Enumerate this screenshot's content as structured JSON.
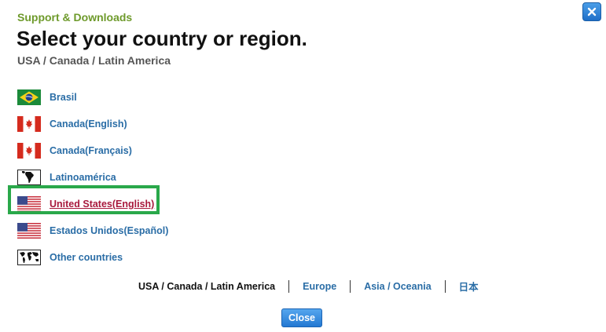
{
  "header": {
    "eyebrow": "Support & Downloads",
    "title": "Select your country or region.",
    "subtitle": "USA / Canada / Latin America"
  },
  "countries": [
    {
      "label": "Brasil",
      "flag": "brazil-flag-icon"
    },
    {
      "label": "Canada(English)",
      "flag": "canada-flag-icon"
    },
    {
      "label": "Canada(Français)",
      "flag": "canada-flag-icon"
    },
    {
      "label": "Latinoamérica",
      "flag": "latin-america-map-icon"
    },
    {
      "label": "United States(English)",
      "flag": "usa-flag-icon",
      "selected": true
    },
    {
      "label": "Estados Unidos(Español)",
      "flag": "usa-flag-icon"
    },
    {
      "label": "Other countries",
      "flag": "world-map-icon"
    }
  ],
  "regions": [
    {
      "label": "USA / Canada / Latin America",
      "current": true
    },
    {
      "label": "Europe"
    },
    {
      "label": "Asia / Oceania"
    },
    {
      "label": "日本"
    }
  ],
  "buttons": {
    "close_label": "Close",
    "close_icon": "close-icon"
  },
  "colors": {
    "eyebrow": "#6e9a2b",
    "link": "#2a6da6",
    "selected_link": "#a8193c",
    "highlight": "#2aa84a",
    "button": "#2378d2"
  }
}
